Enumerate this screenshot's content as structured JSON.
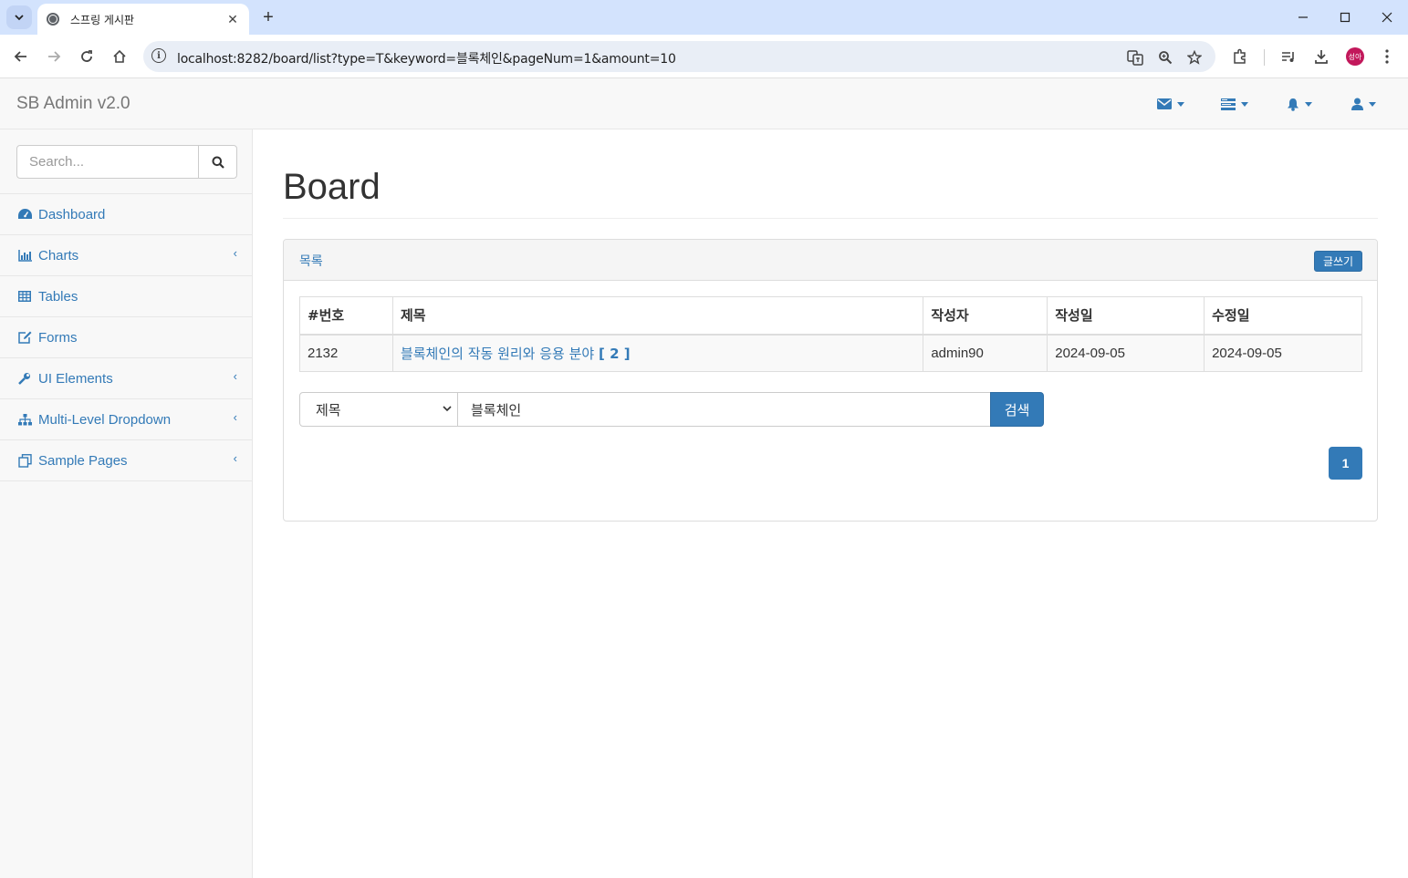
{
  "browser": {
    "tab_title": "스프링 게시판",
    "url": "localhost:8282/board/list?type=T&keyword=블록체인&pageNum=1&amount=10",
    "profile_initials": "성아"
  },
  "navbar": {
    "brand": "SB Admin v2.0"
  },
  "sidebar": {
    "search_placeholder": "Search...",
    "items": [
      {
        "label": "Dashboard",
        "icon": "dashboard-icon"
      },
      {
        "label": "Charts",
        "icon": "bar-chart-icon"
      },
      {
        "label": "Tables",
        "icon": "table-icon"
      },
      {
        "label": "Forms",
        "icon": "edit-icon"
      },
      {
        "label": "UI Elements",
        "icon": "wrench-icon"
      },
      {
        "label": "Multi-Level Dropdown",
        "icon": "sitemap-icon"
      },
      {
        "label": "Sample Pages",
        "icon": "files-icon"
      }
    ]
  },
  "page": {
    "title": "Board",
    "panel_title": "목록",
    "write_button": "글쓰기"
  },
  "table": {
    "headers": [
      "#번호",
      "제목",
      "작성자",
      "작성일",
      "수정일"
    ],
    "rows": [
      {
        "no": "2132",
        "title": "블록체인의 작동 원리와 응용 분야",
        "reply_count": "[ 2 ]",
        "writer": "admin90",
        "regdate": "2024-09-05",
        "updatedate": "2024-09-05"
      }
    ]
  },
  "search": {
    "type_selected": "제목",
    "keyword": "블록체인",
    "submit_label": "검색"
  },
  "pagination": {
    "current_page": "1"
  },
  "colors": {
    "primary": "#337ab7",
    "tab_strip": "#d3e3fd"
  }
}
